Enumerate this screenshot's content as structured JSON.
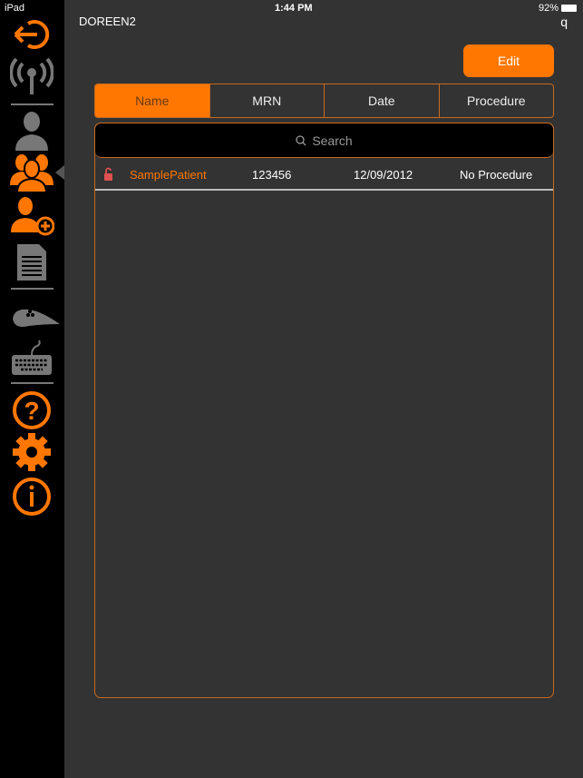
{
  "status_bar": {
    "device": "iPad",
    "time": "1:44 PM",
    "battery": "92%"
  },
  "header": {
    "title": "DOREEN2",
    "right_label": "q"
  },
  "toolbar": {
    "edit_label": "Edit"
  },
  "tabs": [
    {
      "label": "Name",
      "selected": true
    },
    {
      "label": "MRN"
    },
    {
      "label": "Date"
    },
    {
      "label": "Procedure"
    }
  ],
  "search": {
    "placeholder": "Search"
  },
  "patients": [
    {
      "name": "SamplePatient",
      "mrn": "123456",
      "date": "12/09/2012",
      "procedure": "No Procedure",
      "locked": false
    }
  ],
  "colors": {
    "accent": "#ff7700",
    "sidebar": "#000000",
    "background": "#333333",
    "icon_gray": "#777777"
  },
  "sidebar": {
    "items": [
      "logout-icon",
      "wireless-icon",
      "patient-icon",
      "patients-icon",
      "add-patient-icon",
      "document-icon",
      "probe-icon",
      "keyboard-icon",
      "help-icon",
      "settings-icon",
      "info-icon"
    ],
    "active": "patients-icon"
  }
}
